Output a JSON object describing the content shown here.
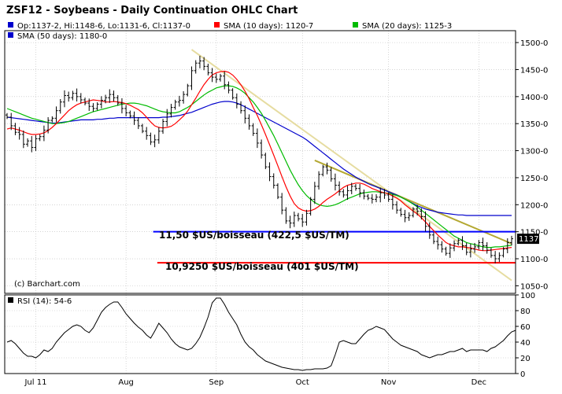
{
  "chart_data": [
    {
      "type": "ohlc",
      "title": "ZSF12 - Soybeans - Daily Continuation OHLC Chart",
      "copyright": "(c) Barchart.com",
      "legend": [
        {
          "name": "Op:1137-2, Hi:1148-6, Lo:1131-6, Cl:1137-0",
          "color": "#0000cc"
        },
        {
          "name": "SMA (10 days): 1120-7",
          "color": "#ff0000"
        },
        {
          "name": "SMA (20 days): 1125-3",
          "color": "#00bb00"
        },
        {
          "name": "SMA (50 days): 1180-0",
          "color": "#0000cc"
        }
      ],
      "x_labels": [
        "Jul 11",
        "Aug",
        "Sep",
        "Oct",
        "Nov",
        "Dec"
      ],
      "x_label_index": [
        7,
        29,
        51,
        72,
        93,
        115
      ],
      "y_ticks": [
        1500,
        1450,
        1400,
        1350,
        1300,
        1250,
        1200,
        1150,
        1100,
        1050
      ],
      "y_tick_labels": [
        "1500-0",
        "1450-0",
        "1400-0",
        "1350-0",
        "1300-0",
        "1250-0",
        "1200-0",
        "1150-0",
        "1100-0",
        "1050-0"
      ],
      "ylim": [
        1036,
        1522
      ],
      "last_price": 1137,
      "last_price_label": "1137-0",
      "close": [
        1362,
        1346,
        1334,
        1330,
        1312,
        1318,
        1306,
        1322,
        1326,
        1338,
        1356,
        1360,
        1374,
        1390,
        1402,
        1398,
        1406,
        1400,
        1394,
        1388,
        1382,
        1378,
        1386,
        1393,
        1398,
        1404,
        1398,
        1388,
        1378,
        1370,
        1364,
        1356,
        1346,
        1336,
        1328,
        1316,
        1320,
        1336,
        1354,
        1368,
        1380,
        1390,
        1393,
        1404,
        1420,
        1448,
        1462,
        1466,
        1456,
        1444,
        1436,
        1432,
        1438,
        1422,
        1412,
        1398,
        1386,
        1374,
        1360,
        1346,
        1332,
        1314,
        1292,
        1270,
        1252,
        1236,
        1214,
        1190,
        1170,
        1166,
        1180,
        1174,
        1168,
        1184,
        1210,
        1234,
        1256,
        1270,
        1264,
        1248,
        1236,
        1224,
        1218,
        1226,
        1234,
        1230,
        1222,
        1216,
        1212,
        1210,
        1214,
        1222,
        1218,
        1210,
        1200,
        1190,
        1182,
        1176,
        1180,
        1192,
        1188,
        1178,
        1160,
        1144,
        1132,
        1126,
        1118,
        1110,
        1120,
        1128,
        1134,
        1124,
        1112,
        1118,
        1122,
        1130,
        1124,
        1116,
        1106,
        1100,
        1106,
        1118,
        1130,
        1137
      ],
      "sma_10": [
        1340,
        1342,
        1340,
        1338,
        1335,
        1332,
        1330,
        1330,
        1331,
        1333,
        1337,
        1343,
        1350,
        1358,
        1366,
        1374,
        1380,
        1385,
        1388,
        1390,
        1392,
        1394,
        1393,
        1392,
        1390,
        1390,
        1391,
        1390,
        1389,
        1387,
        1384,
        1380,
        1376,
        1370,
        1362,
        1353,
        1346,
        1343,
        1342,
        1343,
        1345,
        1350,
        1357,
        1364,
        1373,
        1385,
        1397,
        1410,
        1422,
        1432,
        1440,
        1444,
        1446,
        1447,
        1445,
        1440,
        1432,
        1422,
        1410,
        1396,
        1380,
        1365,
        1348,
        1330,
        1311,
        1292,
        1272,
        1252,
        1233,
        1216,
        1202,
        1194,
        1190,
        1188,
        1189,
        1192,
        1197,
        1204,
        1210,
        1215,
        1220,
        1226,
        1232,
        1236,
        1238,
        1240,
        1240,
        1238,
        1234,
        1230,
        1227,
        1224,
        1222,
        1220,
        1216,
        1212,
        1207,
        1200,
        1194,
        1188,
        1183,
        1176,
        1168,
        1160,
        1152,
        1144,
        1137,
        1130,
        1126,
        1124,
        1122,
        1122,
        1121,
        1120,
        1118,
        1116,
        1115,
        1115,
        1116,
        1117,
        1118,
        1119,
        1120,
        1121
      ],
      "sma_20": [
        1378,
        1375,
        1372,
        1369,
        1366,
        1363,
        1360,
        1358,
        1356,
        1354,
        1352,
        1350,
        1350,
        1351,
        1352,
        1354,
        1357,
        1360,
        1363,
        1366,
        1369,
        1372,
        1374,
        1376,
        1378,
        1380,
        1382,
        1384,
        1386,
        1387,
        1388,
        1388,
        1387,
        1385,
        1383,
        1380,
        1377,
        1374,
        1372,
        1371,
        1370,
        1370,
        1372,
        1376,
        1380,
        1385,
        1391,
        1397,
        1403,
        1408,
        1412,
        1416,
        1418,
        1420,
        1420,
        1419,
        1416,
        1412,
        1406,
        1398,
        1390,
        1380,
        1369,
        1356,
        1342,
        1328,
        1312,
        1296,
        1280,
        1264,
        1250,
        1237,
        1226,
        1217,
        1210,
        1204,
        1200,
        1198,
        1197,
        1198,
        1200,
        1203,
        1207,
        1211,
        1214,
        1217,
        1220,
        1222,
        1223,
        1224,
        1224,
        1223,
        1222,
        1221,
        1219,
        1217,
        1214,
        1210,
        1206,
        1201,
        1196,
        1190,
        1184,
        1178,
        1172,
        1166,
        1160,
        1154,
        1148,
        1142,
        1138,
        1134,
        1130,
        1128,
        1126,
        1124,
        1122,
        1121,
        1121,
        1122,
        1122,
        1123,
        1124,
        1125
      ],
      "sma_50": [
        1362,
        1361,
        1360,
        1359,
        1358,
        1357,
        1356,
        1355,
        1354,
        1353,
        1352,
        1351,
        1351,
        1352,
        1353,
        1354,
        1355,
        1356,
        1357,
        1357,
        1357,
        1357,
        1358,
        1358,
        1359,
        1360,
        1360,
        1361,
        1361,
        1361,
        1361,
        1361,
        1361,
        1361,
        1361,
        1361,
        1361,
        1361,
        1362,
        1362,
        1363,
        1364,
        1365,
        1367,
        1369,
        1371,
        1374,
        1377,
        1380,
        1383,
        1386,
        1388,
        1390,
        1391,
        1391,
        1390,
        1388,
        1385,
        1381,
        1377,
        1373,
        1369,
        1365,
        1361,
        1357,
        1353,
        1349,
        1345,
        1341,
        1337,
        1333,
        1329,
        1325,
        1320,
        1314,
        1308,
        1302,
        1296,
        1290,
        1284,
        1278,
        1272,
        1266,
        1261,
        1256,
        1251,
        1247,
        1243,
        1239,
        1236,
        1233,
        1230,
        1227,
        1224,
        1221,
        1218,
        1214,
        1210,
        1206,
        1202,
        1198,
        1195,
        1192,
        1190,
        1188,
        1186,
        1185,
        1184,
        1183,
        1182,
        1181,
        1181,
        1180,
        1180,
        1180,
        1180,
        1180,
        1180,
        1180,
        1180,
        1180,
        1180,
        1180,
        1180
      ],
      "trendlines": [
        {
          "color": "#e6dca0",
          "from": {
            "index": 45,
            "value": 1487
          },
          "to": {
            "index": 123,
            "value": 1060
          }
        },
        {
          "color": "#b4a832",
          "from": {
            "index": 75,
            "value": 1282
          },
          "to": {
            "index": 123,
            "value": 1128
          }
        }
      ],
      "annotations": [
        {
          "label": "11,50 $US/boisseau (422,5 $US/TM)",
          "value": 1150,
          "color": "#0000ff",
          "start_index": 36
        },
        {
          "label": "10,9250 $US/boisseau (401 $US/TM)",
          "value": 1092.5,
          "color": "#ff0000",
          "start_index": 37
        }
      ],
      "grid": true
    },
    {
      "type": "line",
      "legend": "RSI (14): 54-6",
      "y_ticks": [
        0,
        20,
        40,
        60,
        80,
        100
      ],
      "y_tick_labels": [
        "0",
        "20",
        "40",
        "60",
        "80",
        "100"
      ],
      "ylim": [
        0,
        100
      ],
      "values": [
        40,
        42,
        38,
        32,
        26,
        22,
        22,
        20,
        24,
        30,
        28,
        32,
        40,
        46,
        52,
        56,
        60,
        62,
        60,
        55,
        52,
        58,
        68,
        78,
        84,
        88,
        91,
        91,
        84,
        76,
        70,
        64,
        59,
        55,
        49,
        45,
        54,
        64,
        58,
        52,
        44,
        38,
        34,
        32,
        30,
        32,
        38,
        46,
        58,
        72,
        90,
        96,
        96,
        88,
        78,
        70,
        62,
        50,
        40,
        34,
        30,
        24,
        20,
        16,
        14,
        12,
        10,
        8,
        7,
        6,
        5,
        5,
        4,
        5,
        5,
        6,
        6,
        6,
        7,
        10,
        24,
        40,
        42,
        40,
        38,
        38,
        44,
        50,
        55,
        57,
        60,
        58,
        56,
        50,
        44,
        40,
        36,
        34,
        32,
        30,
        28,
        24,
        22,
        20,
        22,
        24,
        24,
        26,
        28,
        28,
        30,
        32,
        28,
        30,
        30,
        30,
        30,
        28,
        32,
        34,
        38,
        42,
        48,
        53,
        55
      ]
    }
  ]
}
